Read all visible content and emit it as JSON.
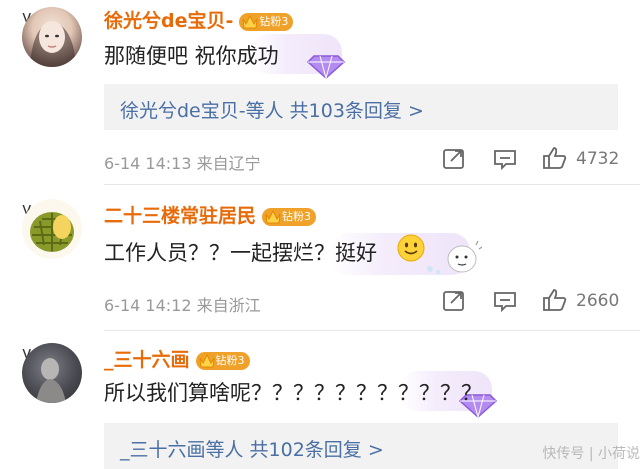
{
  "comments": [
    {
      "name": "徐光兮de宝贝-",
      "fan_badge": "钻粉3",
      "text": "那随便吧 祝你成功",
      "reply": {
        "label": "徐光兮de宝贝-等人 共103条回复 >"
      },
      "meta": "6-14 14:13 来自辽宁",
      "likes": "4732"
    },
    {
      "name": "二十三楼常驻居民",
      "fan_badge": "钻粉3",
      "text": "工作人员？？一起摆烂？挺好",
      "meta": "6-14 14:12 来自浙江",
      "likes": "2660"
    },
    {
      "name": "_三十六画",
      "fan_badge": "钻粉3",
      "text": "所以我们算啥呢？？？？？？？？？？？",
      "reply": {
        "label": "_三十六画等人 共102条回复 >"
      }
    }
  ],
  "colors": {
    "name": "#e86b0a",
    "link": "#4a6fa5",
    "badge": "#f0a12a",
    "vip": "#f6b400"
  },
  "icons": [
    "share-icon",
    "comment-icon",
    "like-icon",
    "smile-emoji",
    "diamond-deco"
  ],
  "watermark": "快传号 | 小荷说"
}
